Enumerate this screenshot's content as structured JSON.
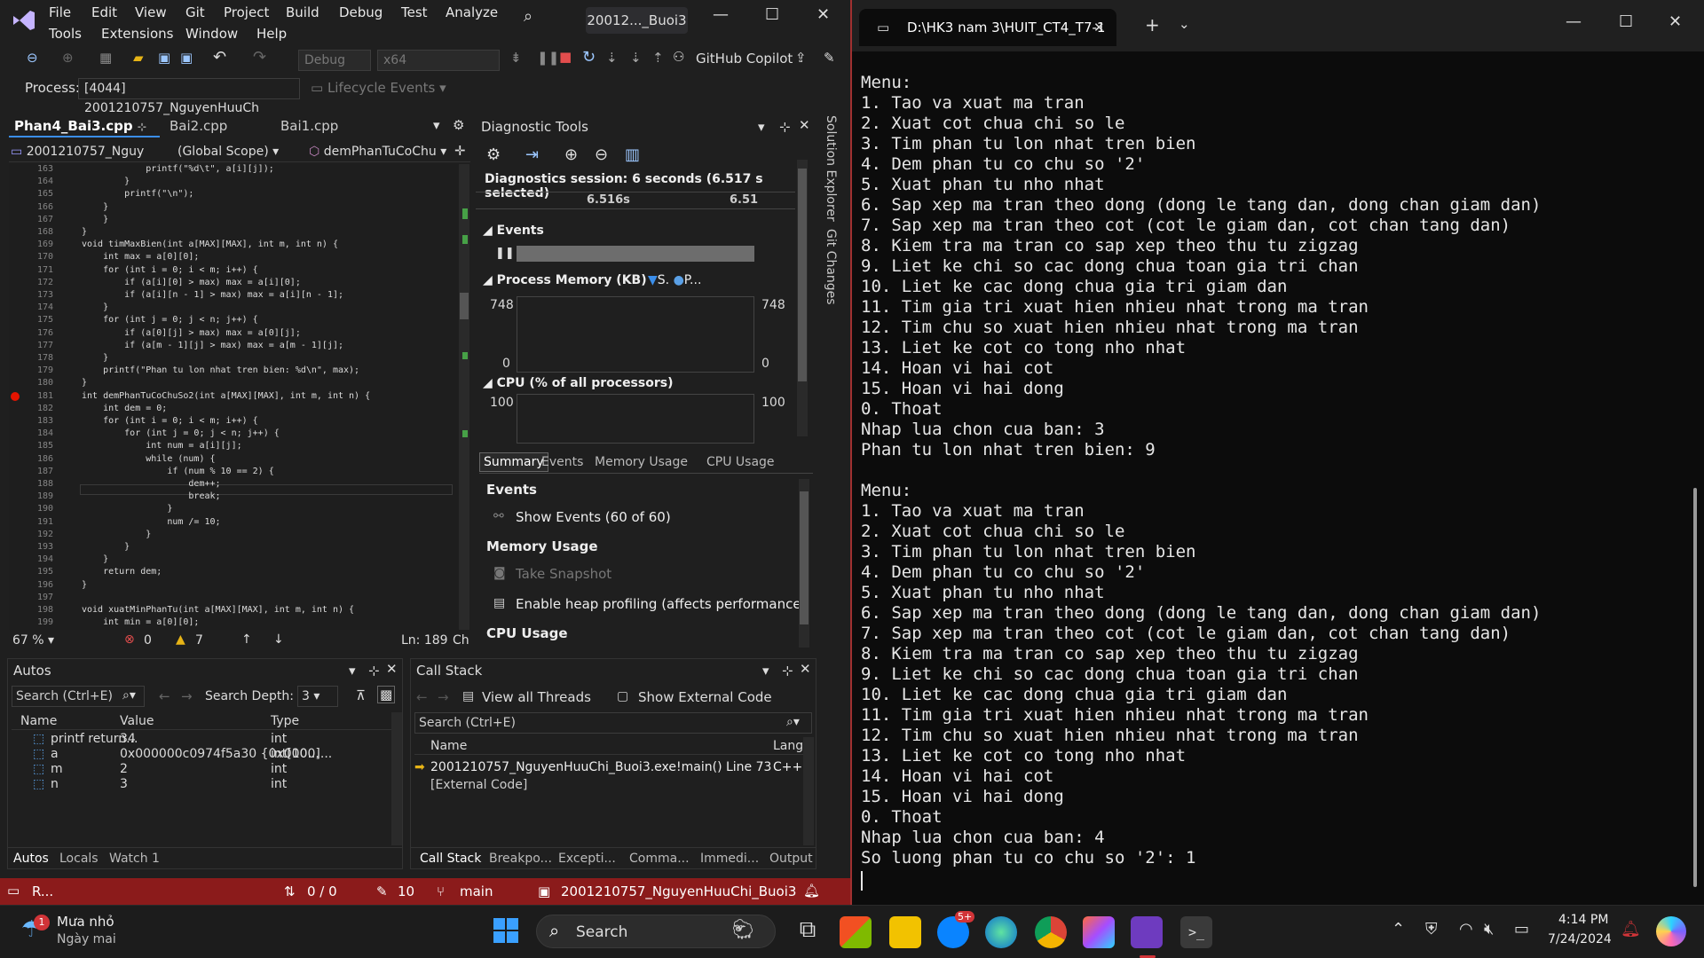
{
  "vs": {
    "menu": [
      "File",
      "Edit",
      "View",
      "Git",
      "Project",
      "Build",
      "Debug",
      "Test",
      "Analyze",
      "Tools",
      "Extensions",
      "Window",
      "Help"
    ],
    "solution_name": "20012..._Buoi3",
    "toolbar": {
      "config": "Debug",
      "platform": "x64",
      "copilot": "GitHub Copilot"
    },
    "process_label": "Process:",
    "process_value": "[4044] 2001210757_NguyenHuuCh",
    "lifecycle": "Lifecycle Events",
    "editor_tabs": [
      "Phan4_Bai3.cpp",
      "Bai2.cpp",
      "Bai1.cpp"
    ],
    "nav": {
      "project": "2001210757_Nguy",
      "scope": "(Global Scope)",
      "member": "demPhanTuCoChu"
    },
    "code_lines": [
      {
        "n": "163",
        "t": "            printf(\"%d\\t\", a[i][j]);"
      },
      {
        "n": "164",
        "t": "        }"
      },
      {
        "n": "165",
        "t": "        printf(\"\\n\");"
      },
      {
        "n": "166",
        "t": "    }"
      },
      {
        "n": "167",
        "t": "    }"
      },
      {
        "n": "168",
        "t": "}"
      },
      {
        "n": "169",
        "t": "void timMaxBien(int a[MAX][MAX], int m, int n) {"
      },
      {
        "n": "170",
        "t": "    int max = a[0][0];"
      },
      {
        "n": "171",
        "t": "    for (int i = 0; i < m; i++) {"
      },
      {
        "n": "172",
        "t": "        if (a[i][0] > max) max = a[i][0];"
      },
      {
        "n": "173",
        "t": "        if (a[i][n - 1] > max) max = a[i][n - 1];"
      },
      {
        "n": "174",
        "t": "    }"
      },
      {
        "n": "175",
        "t": "    for (int j = 0; j < n; j++) {"
      },
      {
        "n": "176",
        "t": "        if (a[0][j] > max) max = a[0][j];"
      },
      {
        "n": "177",
        "t": "        if (a[m - 1][j] > max) max = a[m - 1][j];"
      },
      {
        "n": "178",
        "t": "    }"
      },
      {
        "n": "179",
        "t": "    printf(\"Phan tu lon nhat tren bien: %d\\n\", max);"
      },
      {
        "n": "180",
        "t": "}"
      },
      {
        "n": "181",
        "t": "int demPhanTuCoChuSo2(int a[MAX][MAX], int m, int n) {"
      },
      {
        "n": "182",
        "t": "    int dem = 0;"
      },
      {
        "n": "183",
        "t": "    for (int i = 0; i < m; i++) {"
      },
      {
        "n": "184",
        "t": "        for (int j = 0; j < n; j++) {"
      },
      {
        "n": "185",
        "t": "            int num = a[i][j];"
      },
      {
        "n": "186",
        "t": "            while (num) {"
      },
      {
        "n": "187",
        "t": "                if (num % 10 == 2) {"
      },
      {
        "n": "188",
        "t": "                    dem++;"
      },
      {
        "n": "189",
        "t": "                    break;"
      },
      {
        "n": "190",
        "t": "                }"
      },
      {
        "n": "191",
        "t": "                num /= 10;"
      },
      {
        "n": "192",
        "t": "            }"
      },
      {
        "n": "193",
        "t": "        }"
      },
      {
        "n": "194",
        "t": "    }"
      },
      {
        "n": "195",
        "t": "    return dem;"
      },
      {
        "n": "196",
        "t": "}"
      },
      {
        "n": "197",
        "t": ""
      },
      {
        "n": "198",
        "t": "void xuatMinPhanTu(int a[MAX][MAX], int m, int n) {"
      },
      {
        "n": "199",
        "t": "    int min = a[0][0];"
      }
    ],
    "editor_status": {
      "zoom": "67 %",
      "errors": "0",
      "warnings": "7",
      "line": "Ln: 189",
      "col": "Ch"
    },
    "diag": {
      "title": "Diagnostic Tools",
      "session": "Diagnostics session: 6 seconds (6.517 s selected)",
      "tick1": "6.516s",
      "tick2": "6.51",
      "events_label": "Events",
      "memory_label": "Process Memory (KB)",
      "mem_legend1": "S.",
      "mem_legend2": "P...",
      "mem_max": "748",
      "mem_min": "0",
      "cpu_label": "CPU (% of all processors)",
      "cpu_max": "100",
      "tabs": [
        "Summary",
        "Events",
        "Memory Usage",
        "CPU Usage"
      ],
      "sec_events": "Events",
      "show_events": "Show Events (60 of 60)",
      "sec_memory": "Memory Usage",
      "take_snapshot": "Take Snapshot",
      "heap_profiling": "Enable heap profiling (affects performance)",
      "sec_cpu": "CPU Usage"
    },
    "autos": {
      "title": "Autos",
      "search_placeholder": "Search (Ctrl+E)",
      "depth_label": "Search Depth:",
      "depth_value": "3",
      "columns": [
        "Name",
        "Value",
        "Type"
      ],
      "rows": [
        {
          "name": "printf return...",
          "value": "34",
          "type": "int"
        },
        {
          "name": "a",
          "value": "0x000000c0974f5a30 {0x000...",
          "type": "int[100]..."
        },
        {
          "name": "m",
          "value": "2",
          "type": "int"
        },
        {
          "name": "n",
          "value": "3",
          "type": "int"
        }
      ],
      "tabs": [
        "Autos",
        "Locals",
        "Watch 1"
      ]
    },
    "callstack": {
      "title": "Call Stack",
      "view_threads": "View all Threads",
      "show_external": "Show External Code",
      "search_placeholder": "Search (Ctrl+E)",
      "columns": [
        "Name",
        "Lang"
      ],
      "rows": [
        {
          "name": "2001210757_NguyenHuuChi_Buoi3.exe!main() Line 73",
          "lang": "C++"
        },
        {
          "name": "[External Code]",
          "lang": ""
        }
      ],
      "tabs": [
        "Call Stack",
        "Breakpo...",
        "Excepti...",
        "Comma...",
        "Immedi...",
        "Output"
      ]
    },
    "side_tabs": [
      "Solution Explorer",
      "Git Changes"
    ],
    "status": {
      "ready": "R...",
      "updown": "0 / 0",
      "pencil": "10",
      "branch": "main",
      "project": "2001210757_NguyenHuuChi_Buoi3"
    }
  },
  "terminal": {
    "tab_title": "D:\\HK3 nam 3\\HUIT_CT4_T7-1",
    "lines": [
      "Menu:",
      "1. Tao va xuat ma tran",
      "2. Xuat cot chua chi so le",
      "3. Tim phan tu lon nhat tren bien",
      "4. Dem phan tu co chu so '2'",
      "5. Xuat phan tu nho nhat",
      "6. Sap xep ma tran theo dong (dong le tang dan, dong chan giam dan)",
      "7. Sap xep ma tran theo cot (cot le giam dan, cot chan tang dan)",
      "8. Kiem tra ma tran co sap xep theo thu tu zigzag",
      "9. Liet ke chi so cac dong chua toan gia tri chan",
      "10. Liet ke cac dong chua gia tri giam dan",
      "11. Tim gia tri xuat hien nhieu nhat trong ma tran",
      "12. Tim chu so xuat hien nhieu nhat trong ma tran",
      "13. Liet ke cot co tong nho nhat",
      "14. Hoan vi hai cot",
      "15. Hoan vi hai dong",
      "0. Thoat",
      "Nhap lua chon cua ban: 3",
      "Phan tu lon nhat tren bien: 9",
      "",
      "Menu:",
      "1. Tao va xuat ma tran",
      "2. Xuat cot chua chi so le",
      "3. Tim phan tu lon nhat tren bien",
      "4. Dem phan tu co chu so '2'",
      "5. Xuat phan tu nho nhat",
      "6. Sap xep ma tran theo dong (dong le tang dan, dong chan giam dan)",
      "7. Sap xep ma tran theo cot (cot le giam dan, cot chan tang dan)",
      "8. Kiem tra ma tran co sap xep theo thu tu zigzag",
      "9. Liet ke chi so cac dong chua toan gia tri chan",
      "10. Liet ke cac dong chua gia tri giam dan",
      "11. Tim gia tri xuat hien nhieu nhat trong ma tran",
      "12. Tim chu so xuat hien nhieu nhat trong ma tran",
      "13. Liet ke cot co tong nho nhat",
      "14. Hoan vi hai cot",
      "15. Hoan vi hai dong",
      "0. Thoat",
      "Nhap lua chon cua ban: 4",
      "So luong phan tu co chu so '2': 1"
    ]
  },
  "taskbar": {
    "weather_title": "Mưa nhỏ",
    "weather_sub": "Ngày mai",
    "weather_badge": "1",
    "search": "Search",
    "zalo_badge": "5+",
    "time": "4:14 PM",
    "date": "7/24/2024"
  }
}
